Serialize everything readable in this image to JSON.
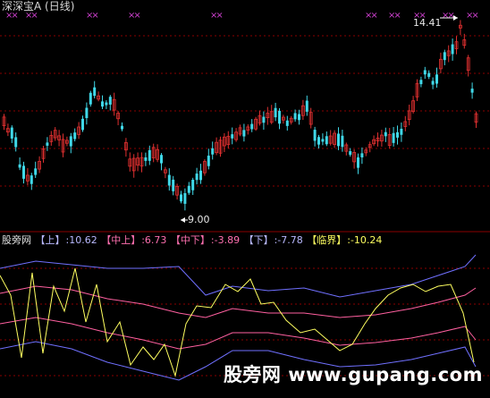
{
  "window": {
    "title": "深深宝A (日线)"
  },
  "markers": {
    "symbol": "××"
  },
  "price_panel": {
    "high_label": "14.41",
    "low_label": "9.00",
    "colors": {
      "up": "#e03030",
      "down": "#40d8e8",
      "grid": "#8a0000"
    }
  },
  "indicator": {
    "name": "股旁网",
    "items": [
      {
        "label": "【上】",
        "value": ":10.62",
        "color": "#b9b9ff"
      },
      {
        "label": "【中上】",
        "value": ":6.73",
        "color": "#ff70b0"
      },
      {
        "label": "【中下】",
        "value": ":-3.89",
        "color": "#ff70b0"
      },
      {
        "label": "【下】",
        "value": ":-7.78",
        "color": "#b9b9ff"
      },
      {
        "label": "【临界】",
        "value": ":-10.24",
        "color": "#ffff60"
      }
    ],
    "colors": {
      "upper": "#7070ff",
      "mid_upper": "#ff60a0",
      "mid_lower": "#ff60a0",
      "lower": "#7070ff",
      "critical": "#ffff60"
    }
  },
  "watermark": {
    "text": "股旁网 www.gupang.com"
  }
}
